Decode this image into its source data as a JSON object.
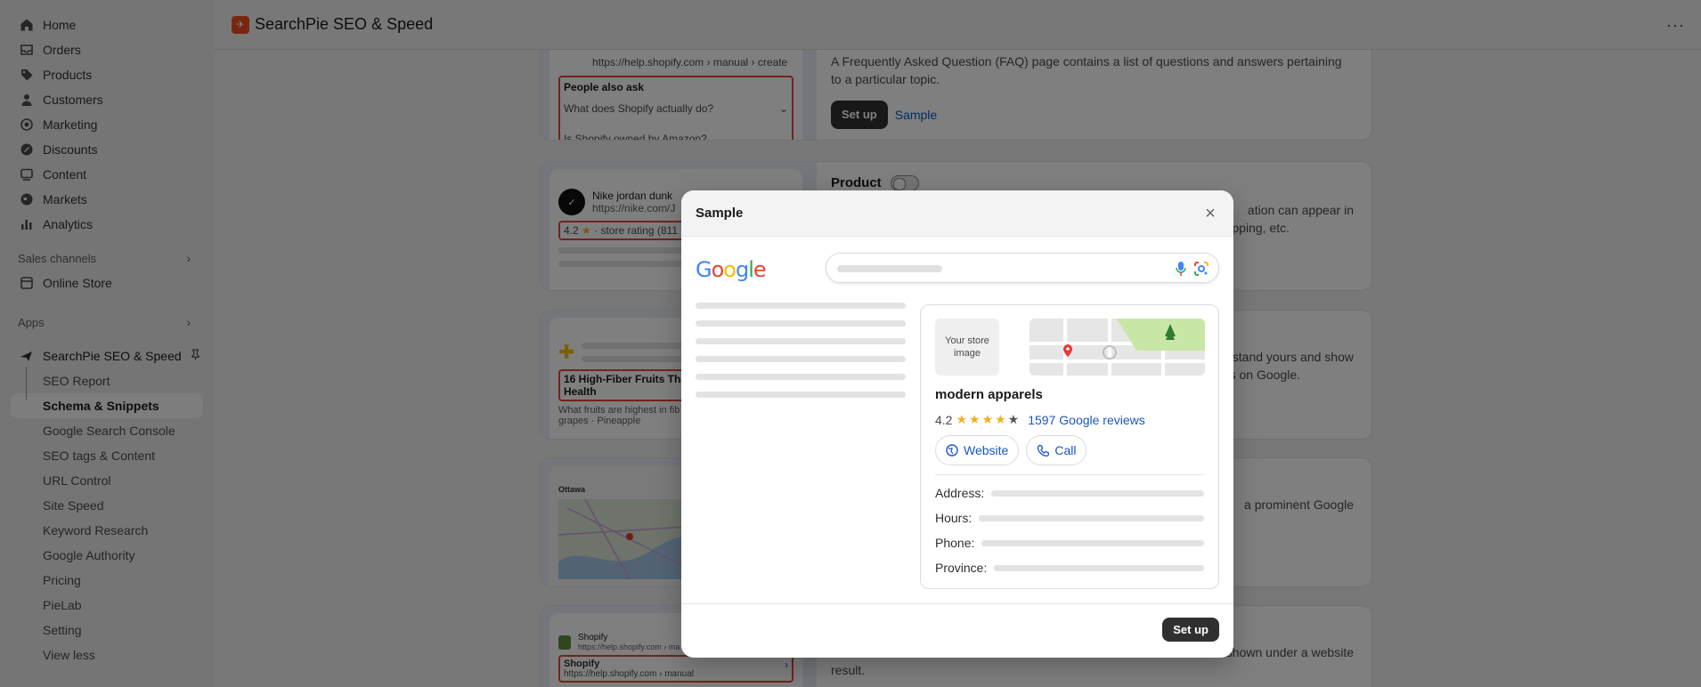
{
  "sidebar": {
    "nav": [
      {
        "label": "Home",
        "icon": "home-icon"
      },
      {
        "label": "Orders",
        "icon": "inbox-icon"
      },
      {
        "label": "Products",
        "icon": "tag-icon"
      },
      {
        "label": "Customers",
        "icon": "person-icon"
      },
      {
        "label": "Marketing",
        "icon": "target-icon"
      },
      {
        "label": "Discounts",
        "icon": "discount-icon"
      },
      {
        "label": "Content",
        "icon": "content-icon"
      },
      {
        "label": "Markets",
        "icon": "globe-icon"
      },
      {
        "label": "Analytics",
        "icon": "bar-chart-icon"
      }
    ],
    "sales_channels": {
      "heading": "Sales channels",
      "items": [
        {
          "label": "Online Store"
        }
      ]
    },
    "apps": {
      "heading": "Apps",
      "app_name": "SearchPie SEO & Speed"
    },
    "app_items": [
      {
        "label": "SEO Report"
      },
      {
        "label": "Schema & Snippets"
      },
      {
        "label": "Google Search Console"
      },
      {
        "label": "SEO tags & Content"
      },
      {
        "label": "URL Control"
      },
      {
        "label": "Site Speed"
      },
      {
        "label": "Keyword Research"
      },
      {
        "label": "Google Authority"
      },
      {
        "label": "Pricing"
      },
      {
        "label": "PieLab"
      },
      {
        "label": "Setting"
      },
      {
        "label": "View less"
      }
    ]
  },
  "topbar": {
    "title": "SearchPie SEO & Speed",
    "more": "···"
  },
  "background": {
    "faq": {
      "url": "https://help.shopify.com › manual › create",
      "paa_title": "People also ask",
      "q1": "What does Shopify actually do?",
      "q2": "Is Shopify owned by Amazon?",
      "desc": "A Frequently Asked Question (FAQ) page contains a list of questions and answers pertaining to a particular topic.",
      "setup": "Set up",
      "sample": "Sample"
    },
    "product": {
      "title": "Product",
      "preview_name": "Nike jordan dunk",
      "preview_url": "https://nike.com/J",
      "preview_rating": "4.2",
      "preview_store": "store rating (811",
      "desc_a": "ation can appear in",
      "desc_b": "ipping, etc."
    },
    "article": {
      "headline": "16 High-Fiber Fruits That",
      "headline2": "Health",
      "snippet": "What fruits are highest in fib",
      "snippet2": "grapes · Pineapple",
      "desc_a": "stand yours and show",
      "desc_b": "lts on Google."
    },
    "local": {
      "city": "Ottawa",
      "desc_a": "a prominent Google"
    },
    "breadcrumb": {
      "site": "Shopify",
      "url": "https://help.shopify.com › ma",
      "box_title": "Shopify",
      "box_url": "https://help.shopify.com › manual",
      "desc_a": "shown under a website",
      "desc_b": "result."
    }
  },
  "modal": {
    "title": "Sample",
    "close": "×",
    "google_logo": "Google",
    "knowledge_panel": {
      "store_image": "Your store image",
      "name": "modern apparels",
      "rating": "4.2",
      "reviews": "1597 Google reviews",
      "website": "Website",
      "call": "Call",
      "address_label": "Address:",
      "hours_label": "Hours:",
      "phone_label": "Phone:",
      "province_label": "Province:"
    },
    "setup_button": "Set up"
  },
  "colors": {
    "accent_dark": "#303030",
    "link": "#005bd3",
    "app_brand": "#f24d20",
    "star": "#f2b01e",
    "highlight_border": "#e04b3a"
  }
}
